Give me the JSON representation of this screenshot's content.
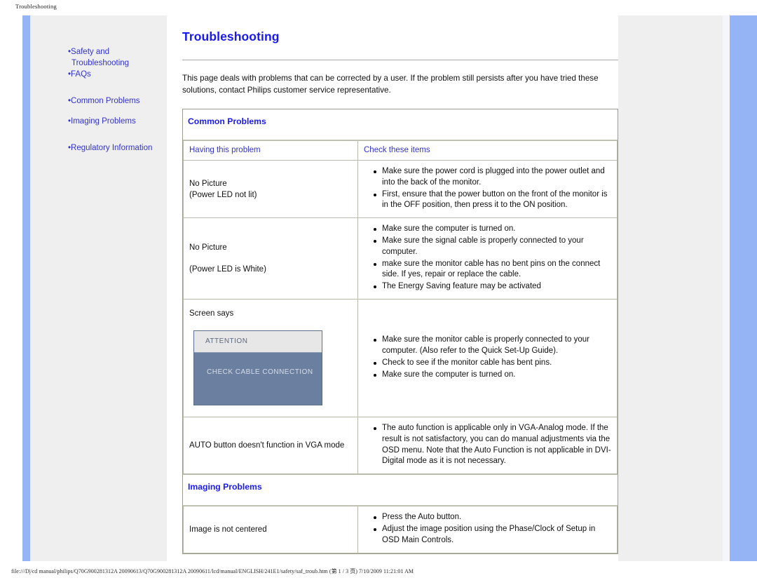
{
  "print": {
    "header": "Troubleshooting",
    "footer": "file:///D|/cd manual/philips/Q70G900281312A 20090613/Q70G900281312A 20090611/lcd/manual/ENGLISH/241E1/safety/saf_troub.htm (第 1 / 3 页) 7/10/2009 11:21:01 AM"
  },
  "colors": {
    "rail_blue": "#95b4f5",
    "sidebar_gray": "#efefef",
    "link_blue": "#3333cc",
    "title_blue": "#1a1aee",
    "osd_header_gray": "#e7e7e7",
    "osd_body_blue": "#6b7fa0"
  },
  "sidebar": {
    "items": [
      {
        "bullet": "•",
        "label": "Safety and"
      },
      {
        "label": "Troubleshooting"
      },
      {
        "bullet": "•",
        "label": "FAQs"
      },
      {
        "bullet": "•",
        "label": "Common Problems"
      },
      {
        "bullet": "•",
        "label": "Imaging Problems"
      },
      {
        "bullet": "•",
        "label": "Regulatory Information"
      }
    ]
  },
  "main": {
    "title": "Troubleshooting",
    "intro": "This page deals with problems that can be corrected by a user. If the problem still persists after you have tried these solutions, contact Philips customer service representative."
  },
  "common_problems": {
    "section_title": "Common Problems",
    "col_headers": {
      "problem": "Having this problem",
      "check": "Check these items"
    },
    "rows": [
      {
        "problem_line1": "No Picture",
        "problem_line2": "(Power LED not lit)",
        "spacer": false,
        "items": [
          "Make sure the power cord is plugged into the power outlet and into the back of the monitor.",
          "First, ensure that the power button on the front of the monitor is in the OFF position, then press it to the ON position."
        ]
      },
      {
        "problem_line1": "No Picture",
        "problem_line2": "(Power LED is White)",
        "spacer": true,
        "items": [
          "Make sure the computer is turned on.",
          "Make sure the signal cable is properly connected to your computer.",
          "make sure the monitor cable has no bent pins on the connect side. If yes, repair or replace the cable.",
          "The Energy Saving feature may be activated"
        ]
      },
      {
        "problem_line1": "Screen says",
        "osd": {
          "title": "ATTENTION",
          "body": "CHECK CABLE CONNECTION"
        },
        "items": [
          "Make sure the monitor cable is properly connected to your computer. (Also refer to the Quick Set-Up Guide).",
          "Check to see if the monitor cable has bent pins.",
          "Make sure the computer is turned on."
        ]
      },
      {
        "problem_line1": "AUTO button doesn't function in VGA mode",
        "items": [
          "The auto function is applicable only in VGA-Analog mode.  If the result is not satisfactory, you can do manual adjustments via the OSD menu.  Note that the Auto Function is not applicable in DVI-Digital mode as it is not necessary."
        ]
      }
    ]
  },
  "imaging_problems": {
    "section_title": "Imaging Problems",
    "rows": [
      {
        "problem_line1": "Image is not centered",
        "items": [
          "Press the Auto button.",
          "Adjust the image position using the Phase/Clock of Setup in OSD Main Controls."
        ]
      }
    ]
  }
}
